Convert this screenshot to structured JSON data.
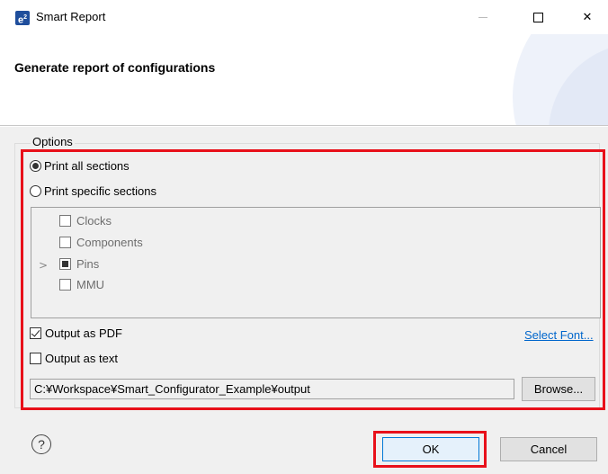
{
  "window": {
    "app_icon_text": "e",
    "app_icon_sup": "2",
    "title": "Smart Report",
    "minimize_glyph": "—",
    "close_glyph": "✕"
  },
  "header": {
    "title": "Generate report of configurations"
  },
  "options": {
    "legend": "Options",
    "print_all_label": "Print all sections",
    "print_all_selected": true,
    "print_specific_label": "Print specific sections",
    "print_specific_selected": false,
    "sections": [
      {
        "label": "Clocks",
        "state": "unchecked",
        "expandable": false
      },
      {
        "label": "Components",
        "state": "unchecked",
        "expandable": false
      },
      {
        "label": "Pins",
        "state": "partial",
        "expandable": true
      },
      {
        "label": "MMU",
        "state": "unchecked",
        "expandable": false
      }
    ],
    "output_pdf_label": "Output as PDF",
    "output_pdf_checked": true,
    "select_font_label": "Select Font...",
    "output_text_label": "Output as text",
    "output_text_checked": false,
    "output_path": "C:¥Workspace¥Smart_Configurator_Example¥output",
    "browse_label": "Browse..."
  },
  "footer": {
    "help_glyph": "?",
    "ok_label": "OK",
    "cancel_label": "Cancel"
  },
  "colors": {
    "highlight": "#e8101a",
    "link": "#0066cc",
    "dialog_bg": "#f0f0f0"
  },
  "icons": [
    "app-icon",
    "minimize-icon",
    "maximize-icon",
    "close-icon",
    "expander-icon",
    "help-icon"
  ]
}
